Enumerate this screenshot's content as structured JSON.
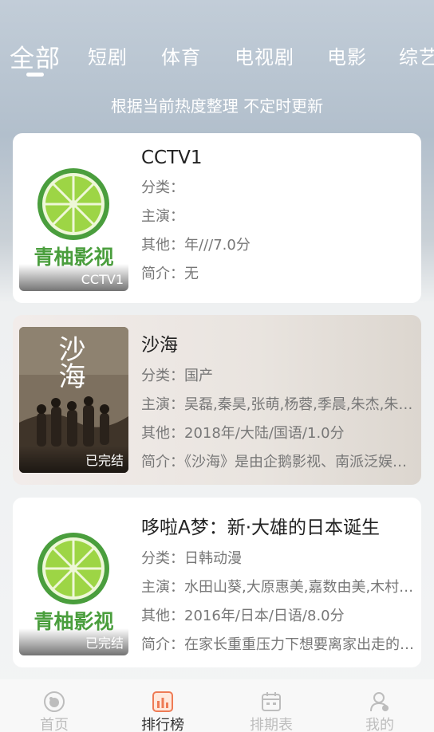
{
  "tabs": [
    {
      "label": "全部",
      "active": true
    },
    {
      "label": "短剧"
    },
    {
      "label": "体育"
    },
    {
      "label": "电视剧"
    },
    {
      "label": "电影"
    },
    {
      "label": "综艺"
    }
  ],
  "subtitle": "根据当前热度整理 不定时更新",
  "items": [
    {
      "title": "CCTV1",
      "category": "分类：",
      "cast": "主演：",
      "other": "其他：年///7.0分",
      "intro": "简介：无",
      "badge": "CCTV1",
      "poster_text": "青柚影视"
    },
    {
      "title": "沙海",
      "category": "分类：国产",
      "cast": "主演：吴磊,秦昊,张萌,杨蓉,季晨,朱杰,朱…",
      "other": "其他：2018年/大陆/国语/1.0分",
      "intro": "简介：《沙海》是由企鹅影视、南派泛娱…",
      "badge": "已完结",
      "poster_text": "沙海"
    },
    {
      "title": "哆啦A梦：新·大雄的日本诞生",
      "category": "分类：日韩动漫",
      "cast": "主演：水田山葵,大原惠美,嘉数由美,木村…",
      "other": "其他：2016年/日本/日语/8.0分",
      "intro": "简介：在家长重重压力下想要离家出走的…",
      "badge": "已完结",
      "poster_text": "青柚影视"
    }
  ],
  "nav": [
    {
      "label": "首页",
      "icon": "home-icon"
    },
    {
      "label": "排行榜",
      "icon": "ranking-icon",
      "active": true
    },
    {
      "label": "排期表",
      "icon": "calendar-icon"
    },
    {
      "label": "我的",
      "icon": "profile-icon"
    }
  ],
  "colors": {
    "accent": "#ee7b55",
    "logo_green": "#4a9e3d",
    "lime": "#9dd545"
  }
}
